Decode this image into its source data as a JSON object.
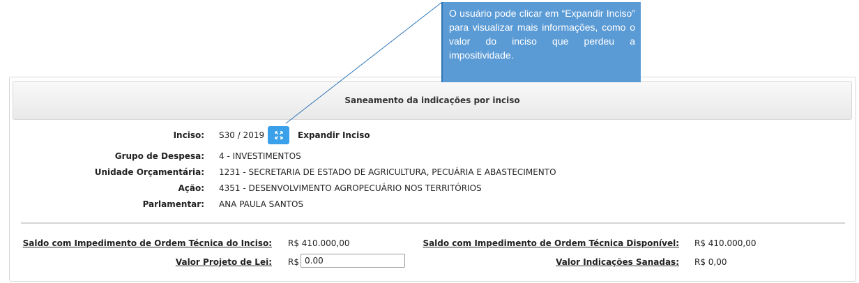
{
  "panel": {
    "title": "Saneamento da indicações por inciso"
  },
  "details": {
    "inciso_label": "Inciso:",
    "inciso_value": "S30 / 2019",
    "expand_label": "Expandir Inciso",
    "grupo_label": "Grupo de Despesa:",
    "grupo_value": "4 - INVESTIMENTOS",
    "unidade_label": "Unidade Orçamentária:",
    "unidade_value": "1231 - SECRETARIA DE ESTADO DE AGRICULTURA, PECUÁRIA E ABASTECIMENTO",
    "acao_label": "Ação:",
    "acao_value": "4351 - DESENVOLVIMENTO AGROPECUÁRIO NOS TERRITÓRIOS",
    "parlamentar_label": "Parlamentar:",
    "parlamentar_value": "ANA PAULA SANTOS"
  },
  "totals": {
    "saldo_inciso_label": "Saldo com Impedimento de Ordem Técnica do Inciso:",
    "saldo_inciso_value": "R$ 410.000,00",
    "saldo_disponivel_label": "Saldo com Impedimento de Ordem Técnica Disponível:",
    "saldo_disponivel_value": "R$ 410.000,00",
    "valor_projeto_label": "Valor Projeto de Lei:",
    "valor_projeto_currency": "R$",
    "valor_projeto_input": "0.00",
    "valor_sanadas_label": "Valor Indicações Sanadas:",
    "valor_sanadas_value": "R$ 0,00"
  },
  "callout": {
    "text": "O usuário pode clicar em “Expandir Inciso” para visualizar mais informações, como o valor do inciso que perdeu a impositividade."
  },
  "colors": {
    "button": "#3aa0ea",
    "callout": "#5b9bd5",
    "leader_line": "#2e75b6"
  },
  "icons": {
    "expand": "expand-arrows-icon"
  }
}
